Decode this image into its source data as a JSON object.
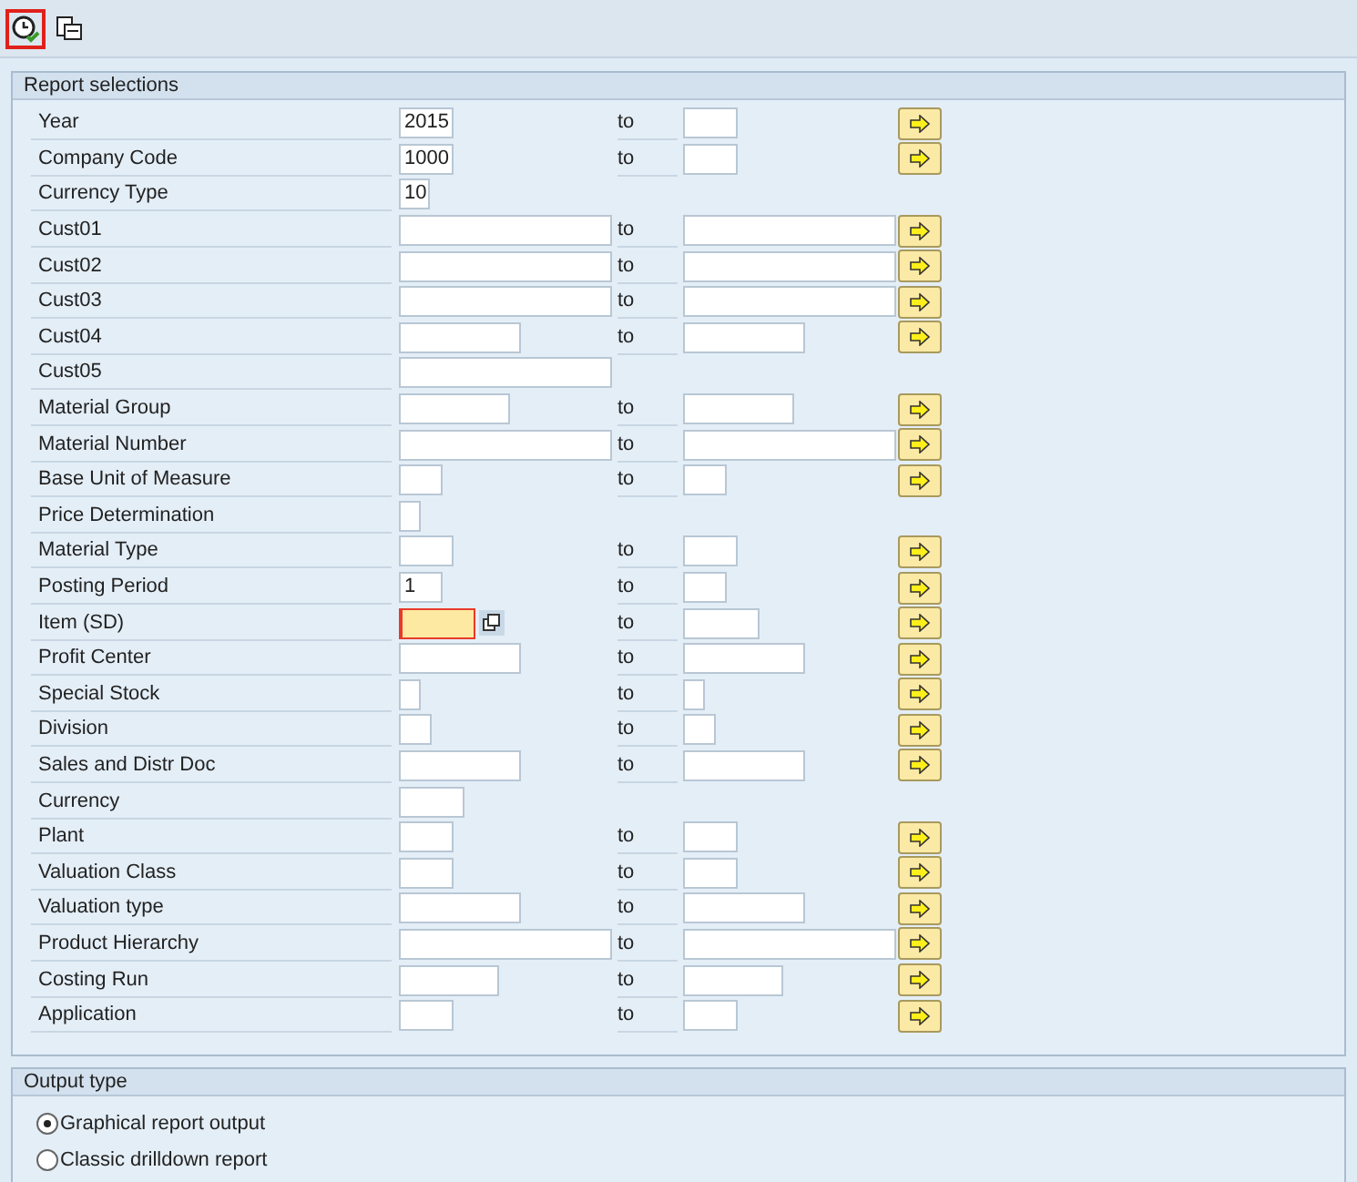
{
  "toolbar": {
    "buttons": [
      {
        "kind": "execute",
        "selected": true
      },
      {
        "kind": "copy",
        "selected": false
      }
    ]
  },
  "report_selections": {
    "title": "Report selections",
    "rows": [
      {
        "label": "Year",
        "from": "2015",
        "to": "to",
        "to_value": ""
      },
      {
        "label": "Company Code",
        "from": "1000",
        "to": "to",
        "to_value": ""
      },
      {
        "label": "Currency Type",
        "from": "10"
      },
      {
        "label": "Cust01",
        "from": "",
        "to": "to",
        "to_value": ""
      },
      {
        "label": "Cust02",
        "from": "",
        "to": "to",
        "to_value": ""
      },
      {
        "label": "Cust03",
        "from": "",
        "to": "to",
        "to_value": ""
      },
      {
        "label": "Cust04",
        "from": "",
        "to": "to",
        "to_value": ""
      },
      {
        "label": "Cust05",
        "from": ""
      },
      {
        "label": "Material Group",
        "from": "",
        "to": "to",
        "to_value": ""
      },
      {
        "label": "Material Number",
        "from": "",
        "to": "to",
        "to_value": ""
      },
      {
        "label": "Base Unit of Measure",
        "from": "",
        "to": "to",
        "to_value": ""
      },
      {
        "label": "Price Determination",
        "from": ""
      },
      {
        "label": "Material Type",
        "from": "",
        "to": "to",
        "to_value": ""
      },
      {
        "label": "Posting Period",
        "from": "1",
        "to": "to",
        "to_value": ""
      },
      {
        "label": "Item (SD)",
        "from": "",
        "focused": true,
        "to": "to",
        "to_value": ""
      },
      {
        "label": "Profit Center",
        "from": "",
        "to": "to",
        "to_value": ""
      },
      {
        "label": "Special Stock",
        "from": "",
        "to": "to",
        "to_value": ""
      },
      {
        "label": "Division",
        "from": "",
        "to": "to",
        "to_value": ""
      },
      {
        "label": "Sales and Distr Doc",
        "from": "",
        "to": "to",
        "to_value": ""
      },
      {
        "label": "Currency",
        "from": ""
      },
      {
        "label": "Plant",
        "from": "",
        "to": "to",
        "to_value": ""
      },
      {
        "label": "Valuation Class",
        "from": "",
        "to": "to",
        "to_value": ""
      },
      {
        "label": "Valuation type",
        "from": "",
        "to": "to",
        "to_value": ""
      },
      {
        "label": "Product Hierarchy",
        "from": "",
        "to": "to",
        "to_value": ""
      },
      {
        "label": "Costing Run",
        "from": "",
        "to": "to",
        "to_value": ""
      },
      {
        "label": "Application",
        "from": "",
        "to": "to",
        "to_value": ""
      }
    ]
  },
  "output_type": {
    "title": "Output type",
    "options": [
      {
        "label": "Graphical report output",
        "selected": true
      },
      {
        "label": "Classic drilldown report",
        "selected": false
      }
    ]
  }
}
